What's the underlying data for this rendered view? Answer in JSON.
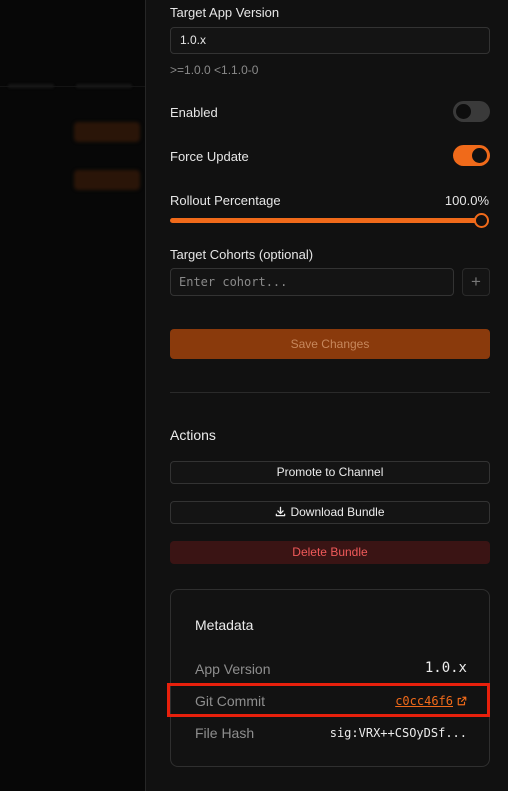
{
  "target_app_version": {
    "label": "Target App Version",
    "value": "1.0.x",
    "hint": ">=1.0.0 <1.1.0-0"
  },
  "enabled": {
    "label": "Enabled",
    "value": false
  },
  "force_update": {
    "label": "Force Update",
    "value": true
  },
  "rollout": {
    "label": "Rollout Percentage",
    "value_text": "100.0%",
    "value": 100
  },
  "cohorts": {
    "label": "Target Cohorts (optional)",
    "placeholder": "Enter cohort...",
    "add_label": "+"
  },
  "save_label": "Save Changes",
  "actions": {
    "title": "Actions",
    "promote_label": "Promote to Channel",
    "download_label": "Download Bundle",
    "delete_label": "Delete Bundle"
  },
  "metadata": {
    "title": "Metadata",
    "app_version_key": "App Version",
    "app_version_value": "1.0.x",
    "git_commit_key": "Git Commit",
    "git_commit_value": "c0cc46f6",
    "file_hash_key": "File Hash",
    "file_hash_value": "sig:VRX++CSOyDSf..."
  },
  "colors": {
    "accent": "#f06a1a",
    "danger": "#f05a5a",
    "highlight": "#e8200c"
  }
}
